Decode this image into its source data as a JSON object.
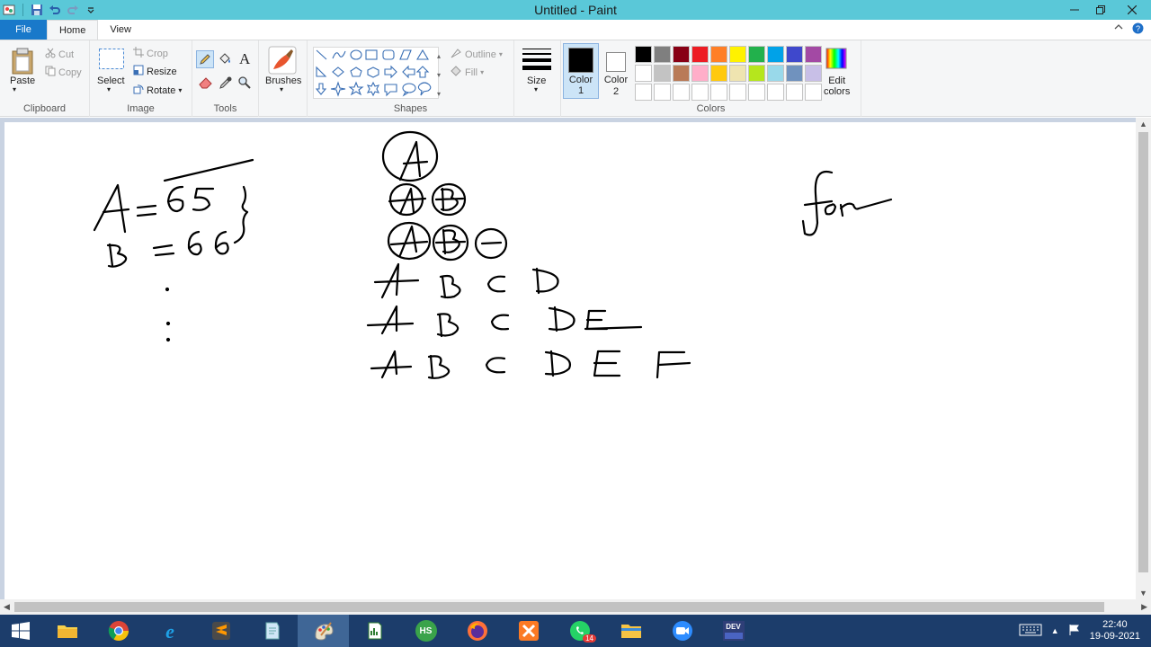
{
  "window": {
    "title": "Untitled - Paint"
  },
  "tabs": {
    "file": "File",
    "home": "Home",
    "view": "View"
  },
  "clipboard": {
    "paste": "Paste",
    "cut": "Cut",
    "copy": "Copy",
    "label": "Clipboard"
  },
  "image": {
    "select": "Select",
    "crop": "Crop",
    "resize": "Resize",
    "rotate": "Rotate",
    "label": "Image"
  },
  "tools": {
    "label": "Tools"
  },
  "brushes": {
    "label": "Brushes"
  },
  "shapes": {
    "outline": "Outline",
    "fill": "Fill",
    "label": "Shapes"
  },
  "size": {
    "label": "Size"
  },
  "colors": {
    "color1": "Color\n1",
    "color1_a": "Color",
    "color1_b": "1",
    "color2_a": "Color",
    "color2_b": "2",
    "edit": "Edit",
    "edit_b": "colors",
    "label": "Colors",
    "palette": [
      "#000000",
      "#7f7f7f",
      "#880015",
      "#ed1c24",
      "#ff7f27",
      "#fff200",
      "#22b14c",
      "#00a2e8",
      "#3f48cc",
      "#a349a4",
      "#ffffff",
      "#c3c3c3",
      "#b97a57",
      "#ffaec9",
      "#ffc90e",
      "#efe4b0",
      "#b5e61d",
      "#99d9ea",
      "#7092be",
      "#c8bfe7",
      "#ffffff",
      "#ffffff",
      "#ffffff",
      "#ffffff",
      "#ffffff",
      "#ffffff",
      "#ffffff",
      "#ffffff",
      "#ffffff",
      "#ffffff"
    ],
    "primary": "#000000",
    "secondary": "#ffffff"
  },
  "taskbar": {
    "time": "22:40",
    "date": "19-09-2021",
    "whatsapp_badge": "14",
    "hs_label": "HS",
    "dev_label": "DEV"
  }
}
